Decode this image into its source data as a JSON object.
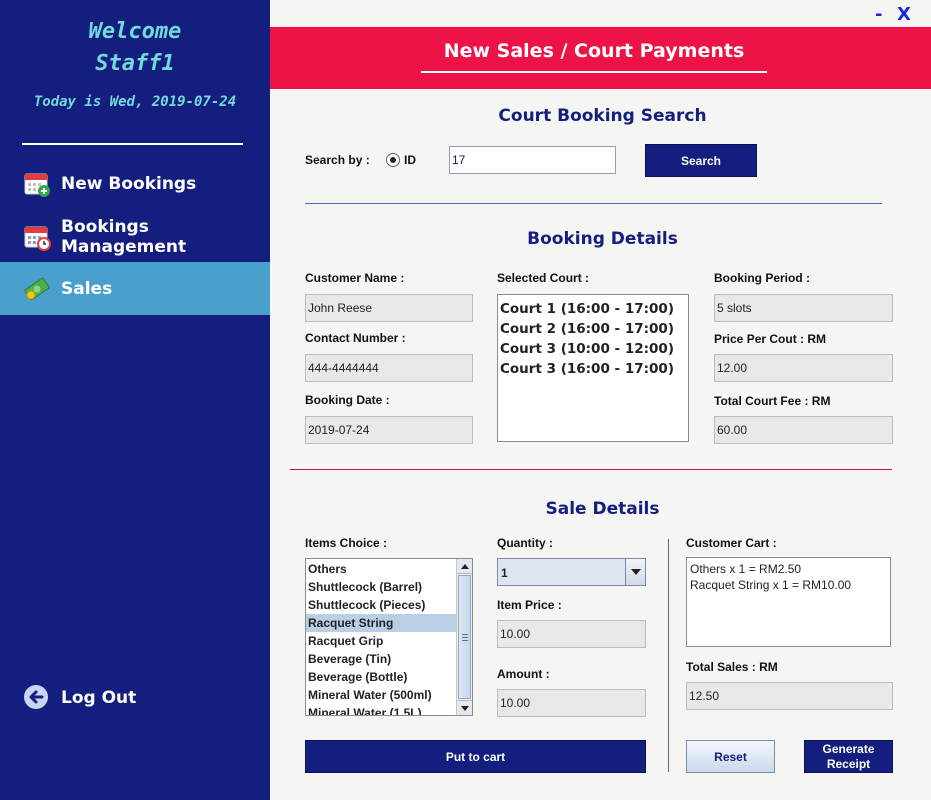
{
  "sidebar": {
    "welcome_line1": "Welcome",
    "welcome_line2": "Staff1",
    "today": "Today is Wed, 2019-07-24",
    "nav": [
      {
        "label": "New Bookings",
        "icon": "calendar-add-icon"
      },
      {
        "label": "Bookings Management",
        "icon": "calendar-clock-icon"
      },
      {
        "label": "Sales",
        "icon": "money-icon"
      }
    ],
    "logout": "Log Out"
  },
  "window": {
    "minimize": "-",
    "close": "X"
  },
  "header": {
    "title": "New Sales / Court Payments"
  },
  "search": {
    "title": "Court Booking Search",
    "search_by_label": "Search by :",
    "radio_label": "ID",
    "input_value": "17",
    "button": "Search"
  },
  "booking": {
    "title": "Booking Details",
    "customer_name_label": "Customer Name :",
    "customer_name": "John Reese",
    "contact_label": "Contact Number :",
    "contact": "444-4444444",
    "date_label": "Booking Date :",
    "date": "2019-07-24",
    "selected_court_label": "Selected Court :",
    "courts": [
      "Court 1 (16:00 - 17:00)",
      "Court 2 (16:00 - 17:00)",
      "Court 3 (10:00 - 12:00)",
      "Court 3 (16:00 - 17:00)"
    ],
    "period_label": "Booking Period :",
    "period": "5 slots",
    "price_label": "Price Per Cout : RM",
    "price": "12.00",
    "total_fee_label": "Total Court Fee : RM",
    "total_fee": "60.00"
  },
  "sale": {
    "title": "Sale Details",
    "items_label": "Items Choice :",
    "items": [
      "Others",
      "Shuttlecock (Barrel)",
      "Shuttlecock (Pieces)",
      "Racquet String",
      "Racquet Grip",
      "Beverage (Tin)",
      "Beverage (Bottle)",
      "Mineral Water (500ml)",
      "Mineral Water (1.5L)"
    ],
    "selected_item": "Racquet String",
    "quantity_label": "Quantity :",
    "quantity": "1",
    "item_price_label": "Item Price :",
    "item_price": "10.00",
    "amount_label": "Amount :",
    "amount": "10.00",
    "put_to_cart": "Put to cart",
    "cart_label": "Customer Cart :",
    "cart": [
      "Others x 1 = RM2.50",
      "Racquet String  x 1 = RM10.00"
    ],
    "total_label": "Total Sales : RM",
    "total": "12.50",
    "reset": "Reset",
    "generate_line1": "Generate",
    "generate_line2": "Receipt"
  },
  "colors": {
    "sidebar": "#141e7f",
    "active_nav": "#4aa0cc",
    "banner": "#ee1347",
    "accent_text": "#72d9dd"
  }
}
